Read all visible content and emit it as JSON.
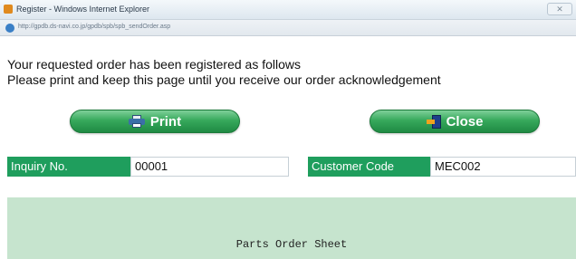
{
  "window": {
    "title": "Register - Windows Internet Explorer",
    "url": "http://gpdb.ds-navi.co.jp/gpdb/spb/spb_sendOrder.asp",
    "close_symbol": "✕"
  },
  "message": {
    "line1": "Your requested order has been registered as follows",
    "line2": "Please print and keep this page until you receive our order acknowledgement"
  },
  "buttons": {
    "print_label": "Print",
    "close_label": "Close"
  },
  "fields": {
    "inquiry_label": "Inquiry No.",
    "inquiry_value": "00001",
    "customer_label": "Customer Code",
    "customer_value": "MEC002"
  },
  "sheet": {
    "title": "Parts Order Sheet"
  },
  "colors": {
    "button_green": "#2f9e55",
    "label_green": "#1f9e5d",
    "panel_green": "#c6e4ce"
  },
  "icons": [
    "ie-app-icon",
    "printer-icon",
    "exit-door-icon"
  ]
}
